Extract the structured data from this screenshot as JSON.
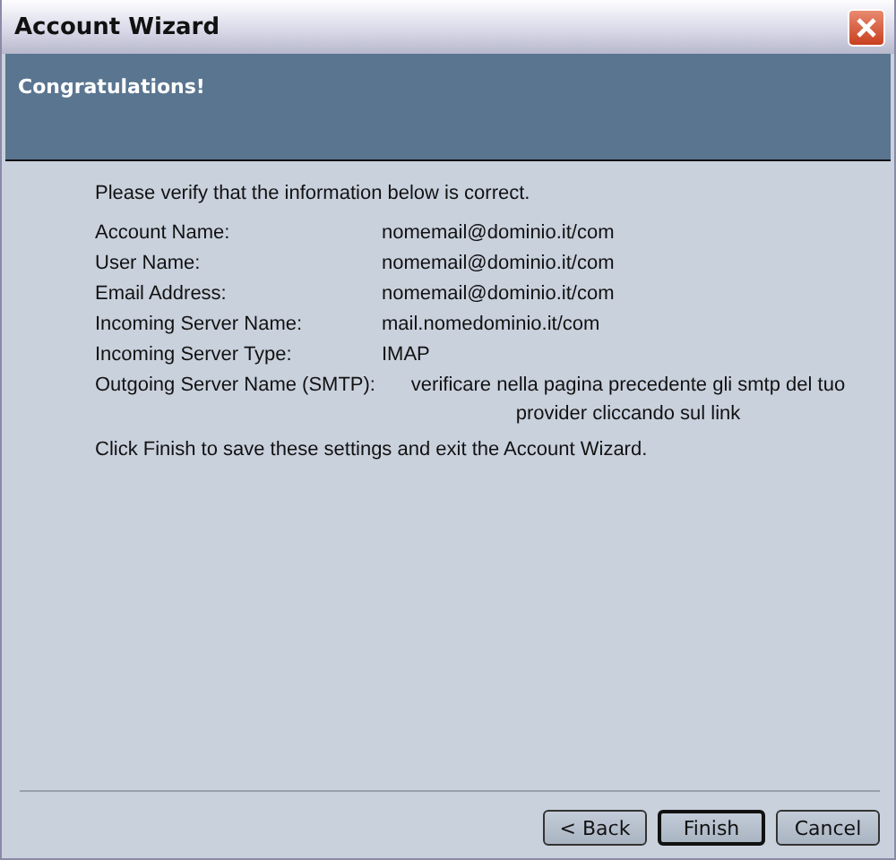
{
  "window": {
    "title": "Account Wizard"
  },
  "header": {
    "title": "Congratulations!"
  },
  "intro": "Please verify that the information below is correct.",
  "fields": [
    {
      "label": "Account Name:",
      "value": "nomemail@dominio.it/com"
    },
    {
      "label": "User Name:",
      "value": "nomemail@dominio.it/com"
    },
    {
      "label": "Email Address:",
      "value": "nomemail@dominio.it/com"
    },
    {
      "label": "Incoming Server Name:",
      "value": "mail.nomedominio.it/com"
    },
    {
      "label": "Incoming Server Type:",
      "value": "IMAP"
    },
    {
      "label": "Outgoing Server Name (SMTP):",
      "value": "verificare nella pagina precedente gli smtp del tuo provider cliccando sul link"
    }
  ],
  "outro": "Click Finish to save these settings and exit the Account Wizard.",
  "buttons": [
    {
      "label": "< Back",
      "default": false
    },
    {
      "label": "Finish",
      "default": true
    },
    {
      "label": "Cancel",
      "default": false
    }
  ]
}
